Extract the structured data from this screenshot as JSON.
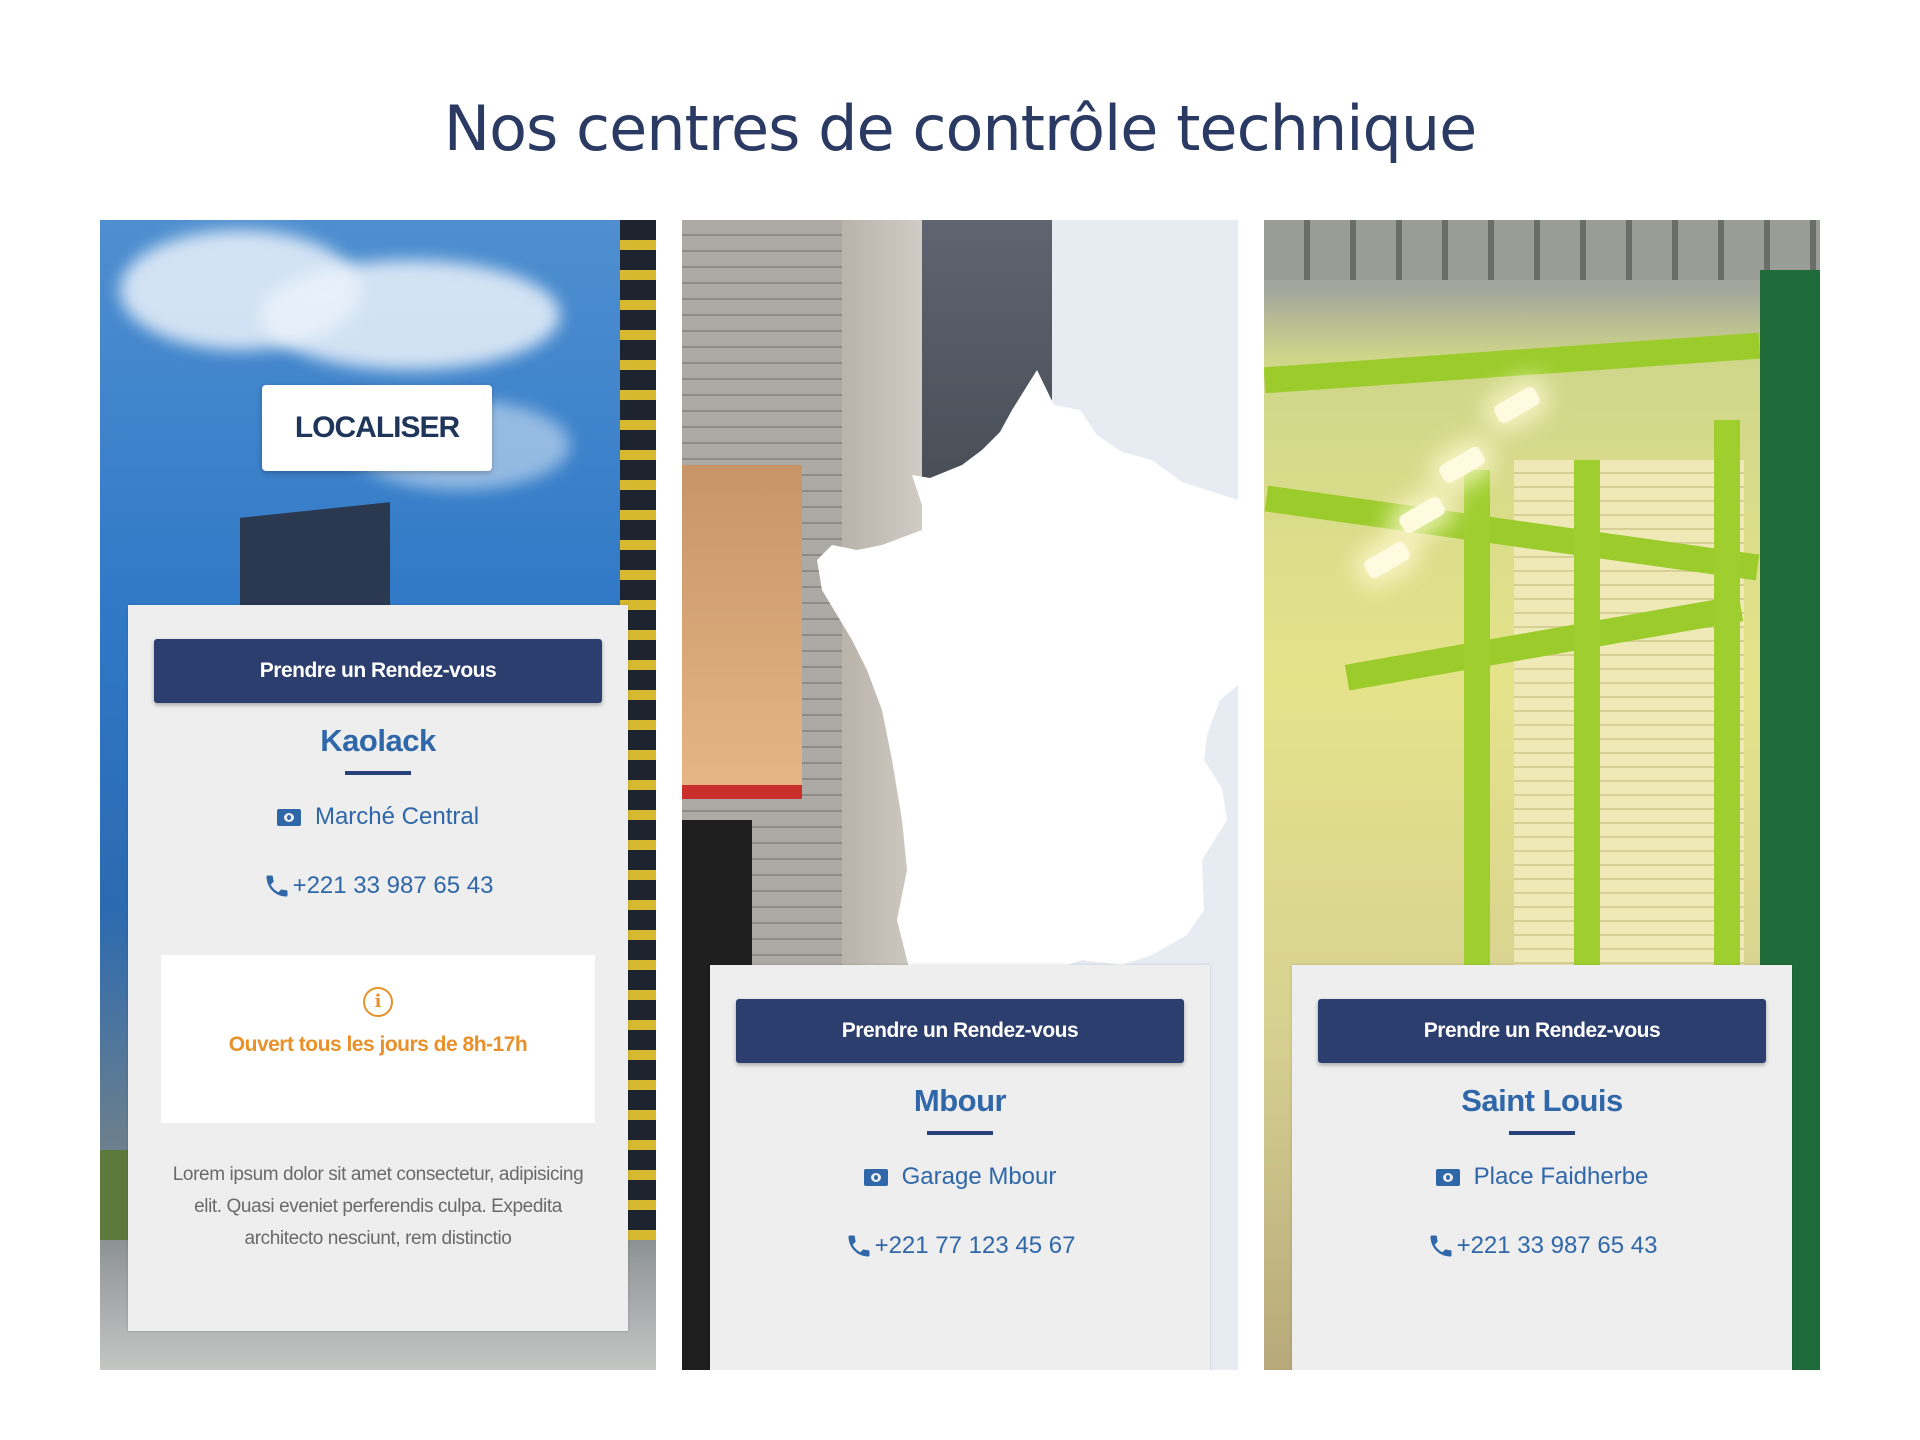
{
  "section": {
    "title": "Nos centres de contrôle technique"
  },
  "colors": {
    "primary": "#2c3e6e",
    "link": "#2f67a8",
    "accent_orange": "#e8912a",
    "panel_bg": "#eeeeef"
  },
  "centers": [
    {
      "button_label": "Prendre un Rendez-vous",
      "city": "Kaolack",
      "address": "Marché Central",
      "address_icon": "map-card-icon",
      "phone": "+221 33 987 65 43",
      "phone_icon": "phone-icon",
      "locate_label": "LOCALISER",
      "hours_icon": "info-icon",
      "hours": "Ouvert tous les jours de 8h-17h",
      "description": "Lorem ipsum dolor sit amet consectetur, adipisicing elit. Quasi eveniet perferendis culpa. Expedita architecto nesciunt, rem distinctio"
    },
    {
      "button_label": "Prendre un Rendez-vous",
      "city": "Mbour",
      "address": "Garage Mbour",
      "address_icon": "map-card-icon",
      "phone": "+221 77 123 45 67",
      "phone_icon": "phone-icon"
    },
    {
      "button_label": "Prendre un Rendez-vous",
      "city": "Saint Louis",
      "address": "Place Faidherbe",
      "address_icon": "map-card-icon",
      "phone": "+221 33 987 65 43",
      "phone_icon": "phone-icon"
    }
  ]
}
